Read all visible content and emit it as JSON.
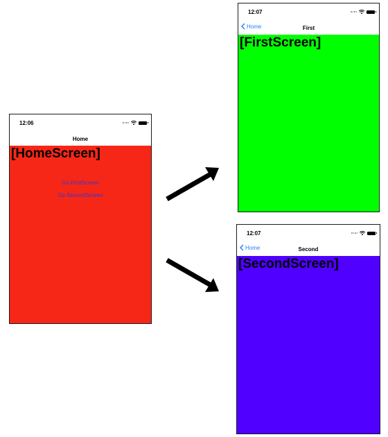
{
  "colors": {
    "home_background": "#f72717",
    "first_background": "#00ff00",
    "second_background": "#4f00ff",
    "link_color": "#3b33cf",
    "back_color": "#2b7cf5"
  },
  "home": {
    "time": "12:06",
    "nav_title": "Home",
    "screen_title": "[HomeScreen]",
    "go_first_label": "Go FirstScreen",
    "go_second_label": "Go SecondScreen"
  },
  "first": {
    "time": "12:07",
    "back_label": "Home",
    "nav_title": "First",
    "screen_title": "[FirstScreen]"
  },
  "second": {
    "time": "12:07",
    "back_label": "Home",
    "nav_title": "Second",
    "screen_title": "[SecondScreen]"
  },
  "icons": {
    "status": [
      "cellular-signal-icon",
      "wifi-icon",
      "battery-icon"
    ],
    "navigation": [
      "back-chevron-icon"
    ],
    "connectors": [
      "arrow-to-first-screen",
      "arrow-to-second-screen"
    ]
  }
}
